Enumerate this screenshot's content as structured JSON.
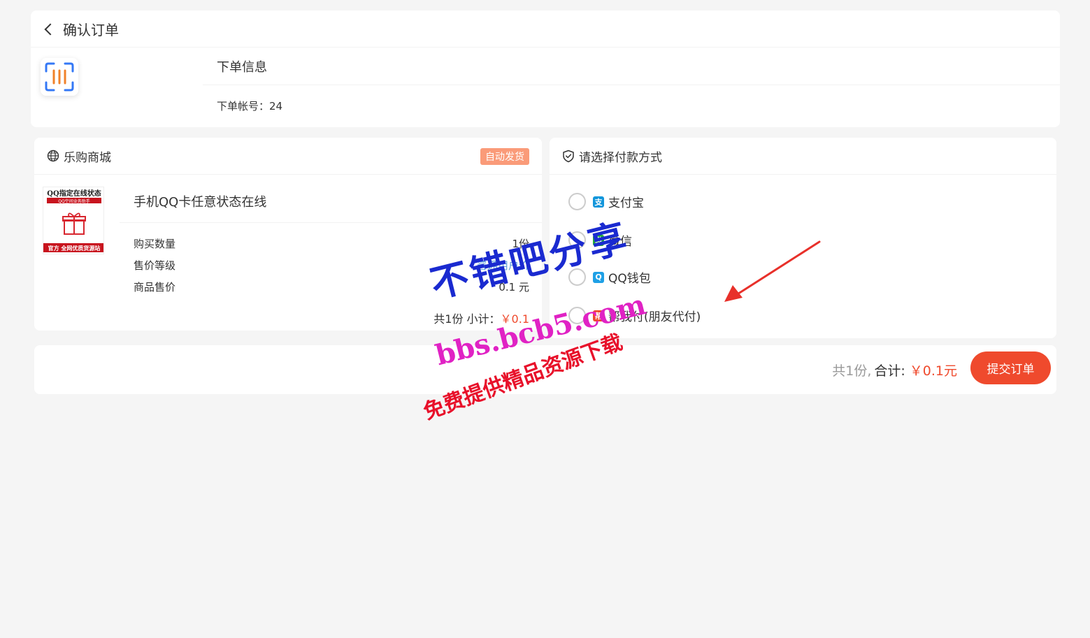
{
  "header": {
    "title": "确认订单"
  },
  "order_info": {
    "title": "下单信息",
    "account_label": "下单帐号：",
    "account_value": "24"
  },
  "shop": {
    "name": "乐购商城",
    "badge": "自动发货",
    "product": {
      "name": "手机QQ卡任意状态在线",
      "image_text_top": "QQ指定在线状态",
      "image_text_sub": "QQ空间业务助手",
      "image_text_bottom": "官方 全网优质货源站"
    },
    "props": [
      {
        "label": "购买数量",
        "value": "1份"
      },
      {
        "label": "售价等级",
        "value": "普通用户价"
      },
      {
        "label": "商品售价",
        "value": "0.1 元"
      }
    ],
    "subtotal_label": "共1份 小计：",
    "subtotal_value": "￥0.1"
  },
  "payment": {
    "title": "请选择付款方式",
    "options": [
      {
        "label": "支付宝",
        "icon": "alipay-icon",
        "icon_glyph": "支",
        "color": "#1296db"
      },
      {
        "label": "微信",
        "icon": "wechat-icon",
        "icon_glyph": "微",
        "color": "#22ac38"
      },
      {
        "label": "QQ钱包",
        "icon": "qq-wallet-icon",
        "icon_glyph": "Q",
        "color": "#1ea0e6"
      },
      {
        "label": "帮我付(朋友代付)",
        "icon": "friend-pay-icon",
        "icon_glyph": "帮",
        "color": "#f04a2e"
      }
    ]
  },
  "footer": {
    "count": "共1份,",
    "total_label": "合计:",
    "total_value": "￥0.1元",
    "submit_label": "提交订单"
  },
  "watermark": {
    "line1": "不错吧分享",
    "line2": "bbs.bcb5.com",
    "line3": "免费提供精品资源下载"
  },
  "colors": {
    "accent": "#ef4a2d",
    "badge": "#fa9b79",
    "background": "#f5f5f5"
  }
}
